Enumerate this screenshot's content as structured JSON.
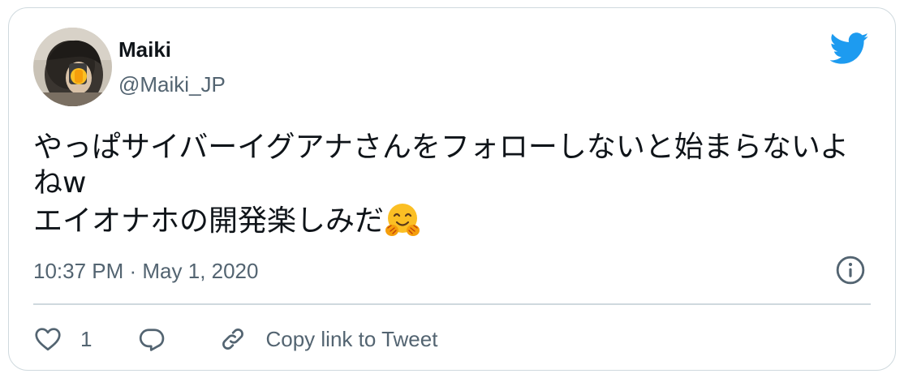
{
  "author": {
    "name": "Maiki",
    "handle": "@Maiki_JP"
  },
  "tweet": {
    "text": "やっぱサイバーイグアナさんをフォローしないと始まらないよねw\nエイオナホの開発楽しみだ",
    "emoji": "hugging-face-emoji"
  },
  "meta": {
    "timestamp": "10:37 PM · May 1, 2020"
  },
  "actions": {
    "like_count": "1",
    "copy_link_label": "Copy link to Tweet"
  },
  "colors": {
    "brand": "#1d9bf0",
    "secondary_text": "#536471",
    "border": "#cfd9de"
  },
  "icons": [
    "twitter-bird-icon",
    "info-icon",
    "heart-icon",
    "reply-icon",
    "link-icon"
  ]
}
